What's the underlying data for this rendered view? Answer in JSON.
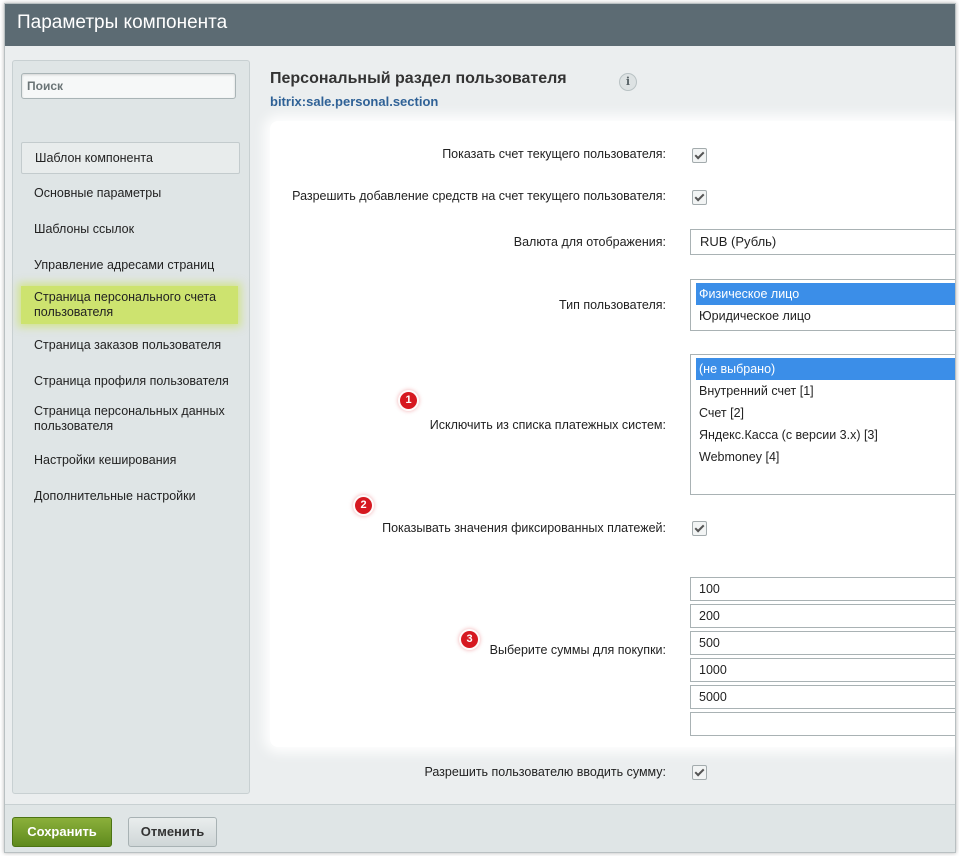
{
  "window": {
    "title": "Параметры компонента"
  },
  "sidebar": {
    "search_placeholder": "Поиск",
    "items": [
      {
        "label": "Шаблон компонента"
      },
      {
        "label": "Основные параметры"
      },
      {
        "label": "Шаблоны ссылок"
      },
      {
        "label": "Управление адресами страниц"
      },
      {
        "label": "Страница персонального счета пользователя"
      },
      {
        "label": "Страница заказов пользователя"
      },
      {
        "label": "Страница профиля пользователя"
      },
      {
        "label": "Страница персональных данных пользователя"
      },
      {
        "label": "Настройки кеширования"
      },
      {
        "label": "Дополнительные настройки"
      }
    ]
  },
  "component": {
    "title": "Персональный раздел пользователя",
    "info_icon": "i",
    "code": "bitrix:sale.personal.section"
  },
  "form": {
    "show_account_label": "Показать счет текущего пользователя:",
    "allow_add_funds_label": "Разрешить добавление средств на счет текущего пользователя:",
    "currency_label": "Валюта для отображения:",
    "currency_value": "RUB (Рубль)",
    "user_type_label": "Тип пользователя:",
    "user_type_options": [
      "Физическое лицо",
      "Юридическое лицо"
    ],
    "exclude_ps_label": "Исключить из списка платежных систем:",
    "exclude_ps_options": [
      "(не выбрано)",
      "Внутренний счет [1]",
      "Счет [2]",
      "Яндекс.Касса (с версии 3.x) [3]",
      "Webmoney [4]"
    ],
    "show_fixed_label": "Показывать значения фиксированных платежей:",
    "amounts_label": "Выберите суммы для покупки:",
    "amounts": [
      "100",
      "200",
      "500",
      "1000",
      "5000",
      ""
    ],
    "allow_custom_sum_label": "Разрешить пользователю вводить сумму:"
  },
  "badges": [
    "1",
    "2",
    "3"
  ],
  "buttons": {
    "save": "Сохранить",
    "cancel": "Отменить"
  },
  "colors": {
    "accent_green": "#cde36f",
    "selection_blue": "#3b8ee8",
    "badge_red": "#d61820",
    "save_green": "#6f9a27"
  }
}
